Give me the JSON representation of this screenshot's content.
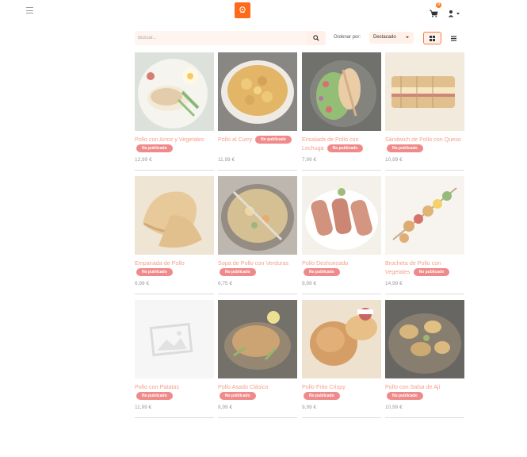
{
  "header": {
    "menu_icon": "hamburger-icon",
    "logo_icon": "chef-hat-icon",
    "cart_icon": "cart-icon",
    "cart_count": "0",
    "user_icon": "user-icon"
  },
  "toolbar": {
    "search_placeholder": "Buscar...",
    "search_icon": "search-icon",
    "sort_label": "Ordenar por:",
    "sort_value": "Destacado",
    "grid_view_icon": "grid-view-icon",
    "list_view_icon": "list-view-icon"
  },
  "colors": {
    "accent": "#ff6a1a",
    "badge": "#f08a8a",
    "title": "#f5a08a"
  },
  "products": [
    {
      "title": "Pollo con Arroz y Vegetales",
      "badge": "No publicado",
      "price": "12,99 €"
    },
    {
      "title": "Pollo al Curry",
      "badge": "No publicado",
      "price": "11,99 €"
    },
    {
      "title": "Ensalada de Pollo con Lechuga",
      "badge": "No publicado",
      "price": "7,99 €"
    },
    {
      "title": "Sándwich de Pollo con Queso",
      "badge": "No publicado",
      "price": "10,99 €"
    },
    {
      "title": "Empanada de Pollo",
      "badge": "No publicado",
      "price": "6,99 €"
    },
    {
      "title": "Sopa de Pollo con Verduras",
      "badge": "No publicado",
      "price": "6,75 €"
    },
    {
      "title": "Pollo Deshuesado",
      "badge": "No publicado",
      "price": "9,99 €"
    },
    {
      "title": "Brocheta de Pollo con Vegetales",
      "badge": "No publicado",
      "price": "14,99 €"
    },
    {
      "title": "Pollo con Patatas",
      "badge": "No publicado",
      "price": "11,99 €"
    },
    {
      "title": "Pollo Asado Clásico",
      "badge": "No publicado",
      "price": "8,99 €"
    },
    {
      "title": "Pollo Frito Crispy",
      "badge": "No publicado",
      "price": "9,99 €"
    },
    {
      "title": "Pollo con Salsa de Ají",
      "badge": "No publicado",
      "price": "10,99 €"
    }
  ]
}
